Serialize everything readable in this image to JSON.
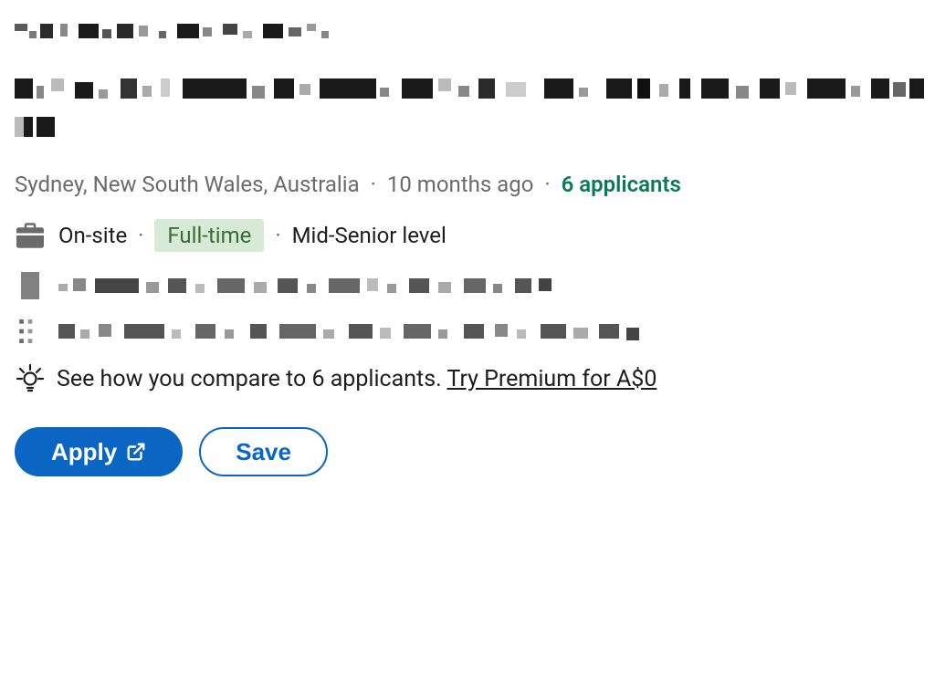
{
  "meta": {
    "location": "Sydney, New South Wales, Australia",
    "posted": "10 months ago",
    "applicants": "6 applicants"
  },
  "jobDetails": {
    "workplaceType": "On-site",
    "employmentType": "Full-time",
    "seniority": "Mid-Senior level"
  },
  "premium": {
    "text": "See how you compare to 6 applicants.",
    "linkText": "Try Premium for A$0"
  },
  "buttons": {
    "apply": "Apply",
    "save": "Save"
  }
}
